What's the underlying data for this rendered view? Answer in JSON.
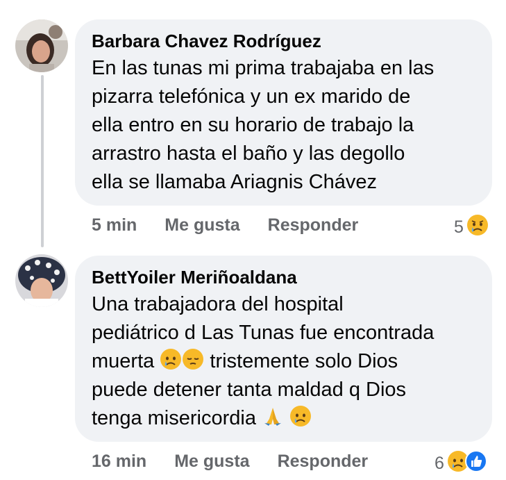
{
  "comments": [
    {
      "author": "Barbara Chavez Rodríguez",
      "lines": [
        "En las tunas mi prima trabajaba en las",
        "pizarra telefónica y un ex marido de",
        "ella entro en su horario de trabajo la",
        "arrastro hasta el baño y las degollo",
        "ella se llamaba Ariagnis Chávez"
      ],
      "time": "5 min",
      "like_label": "Me gusta",
      "reply_label": "Responder",
      "reaction_count": "5",
      "reaction_icons": [
        "sad-face-icon"
      ]
    },
    {
      "author": "BettYoiler Meriñoaldana",
      "lines": [
        "Una trabajadora del hospital",
        "pediátrico d Las Tunas fue encontrada",
        "muerta",
        "tristemente solo Dios",
        "puede detener tanta maldad q Dios",
        "tenga misericordia"
      ],
      "time": "16 min",
      "like_label": "Me gusta",
      "reply_label": "Responder",
      "reaction_count": "6",
      "reaction_icons": [
        "sad-face-icon",
        "like-thumb-icon"
      ]
    }
  ],
  "colors": {
    "bubble": "#f0f2f5",
    "meta": "#65676b",
    "like_blue": "#1877f2",
    "sad_yellow": "#f7b928"
  }
}
